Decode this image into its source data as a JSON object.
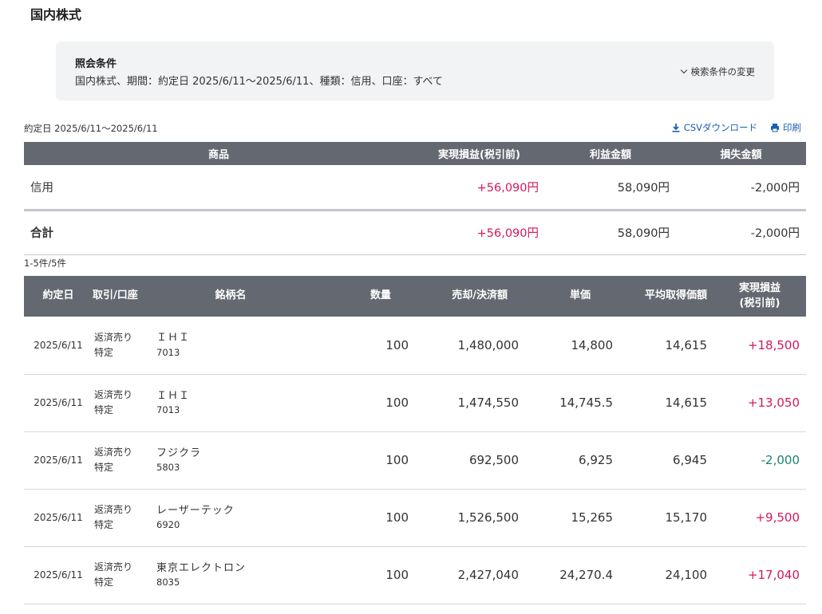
{
  "page": {
    "title": "国内株式"
  },
  "conditions": {
    "label": "照会条件",
    "text": "国内株式、期間：約定日 2025/6/11〜2025/6/11、種類：信用、口座：すべて",
    "change_label": "検索条件の変更"
  },
  "range": {
    "text": "約定日 2025/6/11〜2025/6/11"
  },
  "tools": {
    "csv_label": "CSVダウンロード",
    "print_label": "印刷"
  },
  "summary": {
    "headers": {
      "product": "商品",
      "realized": "実現損益(税引前)",
      "profit": "利益金額",
      "loss": "損失金額"
    },
    "credit": {
      "name": "信用",
      "realized": "+56,090円",
      "profit": "58,090円",
      "loss": "-2,000円"
    },
    "total": {
      "name": "合計",
      "realized": "+56,090円",
      "profit": "58,090円",
      "loss": "-2,000円"
    }
  },
  "count": {
    "text": "1-5件/5件"
  },
  "detail": {
    "headers": {
      "date": "約定日",
      "type": "取引/口座",
      "name": "銘柄名",
      "qty": "数量",
      "amount": "売却/決済額",
      "price": "単価",
      "avg": "平均取得価額",
      "realized_line1": "実現損益",
      "realized_line2": "(税引前)"
    },
    "rows": [
      {
        "date": "2025/6/11",
        "trade": "返済売り",
        "account": "特定",
        "name": "ＩＨＩ",
        "code": "7013",
        "qty": "100",
        "amount": "1,480,000",
        "price": "14,800",
        "avg": "14,615",
        "realized": "+18,500"
      },
      {
        "date": "2025/6/11",
        "trade": "返済売り",
        "account": "特定",
        "name": "ＩＨＩ",
        "code": "7013",
        "qty": "100",
        "amount": "1,474,550",
        "price": "14,745.5",
        "avg": "14,615",
        "realized": "+13,050"
      },
      {
        "date": "2025/6/11",
        "trade": "返済売り",
        "account": "特定",
        "name": "フジクラ",
        "code": "5803",
        "qty": "100",
        "amount": "692,500",
        "price": "6,925",
        "avg": "6,945",
        "realized": "-2,000"
      },
      {
        "date": "2025/6/11",
        "trade": "返済売り",
        "account": "特定",
        "name": "レーザーテック",
        "code": "6920",
        "qty": "100",
        "amount": "1,526,500",
        "price": "15,265",
        "avg": "15,170",
        "realized": "+9,500"
      },
      {
        "date": "2025/6/11",
        "trade": "返済売り",
        "account": "特定",
        "name": "東京エレクトロン",
        "code": "8035",
        "qty": "100",
        "amount": "2,427,040",
        "price": "24,270.4",
        "avg": "24,100",
        "realized": "+17,040"
      }
    ]
  },
  "colors": {
    "header_bg": "#646870",
    "positive": "#d6175e",
    "negative": "#1b8273",
    "link": "#1a5fb4",
    "panel_bg": "#f2f3f4"
  },
  "icons": {
    "csv": "download-icon",
    "print": "printer-icon",
    "change": "chevron-down-icon"
  }
}
